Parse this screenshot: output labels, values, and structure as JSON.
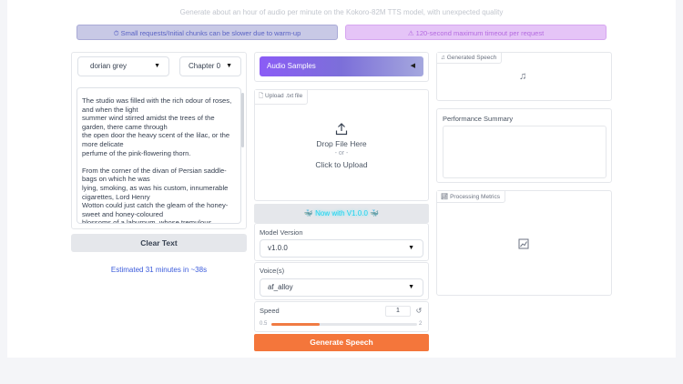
{
  "header": {
    "subtitle": "Generate about an hour of audio per minute on the Kokoro-82M TTS model, with unexpected quality"
  },
  "banners": {
    "left": {
      "icon": "clock-icon",
      "glyph": "⏱",
      "text": "Small requests/Initial chunks can be slower due to warm-up"
    },
    "right": {
      "icon": "warning-icon",
      "glyph": "⚠",
      "text": "120-second maximum timeout per request"
    }
  },
  "book_select": {
    "value": "dorian grey"
  },
  "chapter_select": {
    "value": "Chapter 0"
  },
  "text_input": {
    "value": "The studio was filled with the rich odour of roses, and when the light\nsummer wind stirred amidst the trees of the garden, there came through\nthe open door the heavy scent of the lilac, or the more delicate\nperfume of the pink-flowering thorn.\n\nFrom the corner of the divan of Persian saddle-bags on which he was\nlying, smoking, as was his custom, innumerable cigarettes, Lord Henry\nWotton could just catch the gleam of the honey-sweet and honey-coloured\nblossoms of a laburnum, whose tremulous"
  },
  "clear_button": {
    "label": "Clear Text"
  },
  "estimate": {
    "text": "Estimated 31 minutes in ~38s"
  },
  "audio_samples": {
    "label": "Audio Samples",
    "arrow": "◀"
  },
  "upload": {
    "tag": "Upload .txt file",
    "line1": "Drop File Here",
    "line2": "- or -",
    "line3": "Click to Upload"
  },
  "version_banner": {
    "text": "Now with V1.0.0",
    "emoji": "🐳"
  },
  "model_version": {
    "label": "Model Version",
    "value": "v1.0.0"
  },
  "voice": {
    "label": "Voice(s)",
    "value": "af_alloy"
  },
  "speed": {
    "label": "Speed",
    "value": "1",
    "min_label": "0.5",
    "max_label": "2",
    "fraction": 0.333,
    "reset_icon": "reset-icon"
  },
  "generate_button": {
    "label": "Generate Speech"
  },
  "generated_speech": {
    "tag": "Generated Speech"
  },
  "performance": {
    "label": "Performance Summary"
  },
  "metrics": {
    "tag": "Processing Metrics"
  },
  "colors": {
    "accent": "#f4763b",
    "purple": "#8b5cf6",
    "link_blue": "#3b5bdb"
  }
}
